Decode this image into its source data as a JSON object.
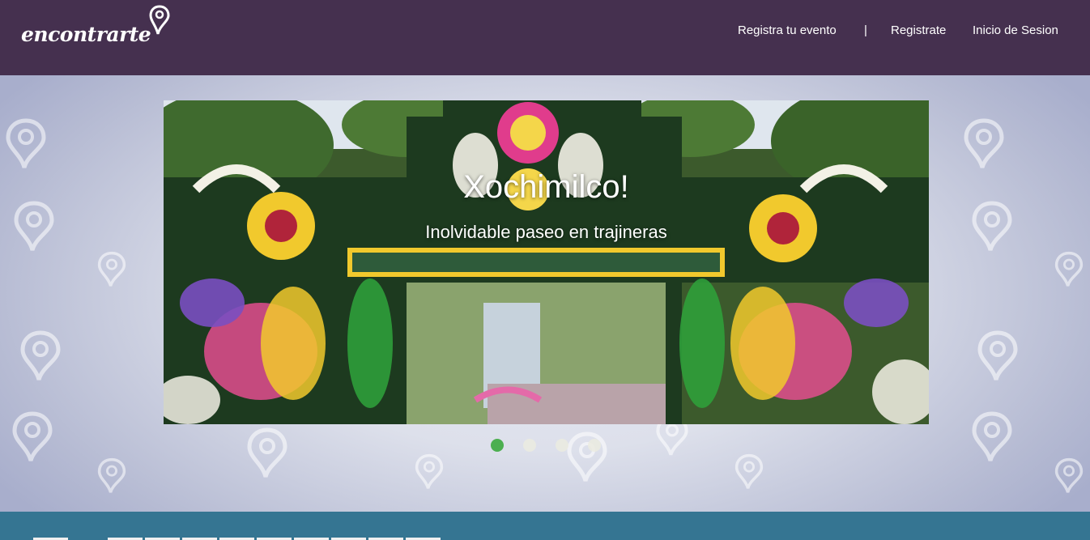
{
  "header": {
    "logo_text": "encontrarte",
    "nav": {
      "register_event": "Registra tu evento",
      "separator": "|",
      "register": "Registrate",
      "login": "Inicio de Sesion"
    }
  },
  "carousel": {
    "slide": {
      "title": "Xochimilco!",
      "subtitle": "Inolvidable paseo en trajineras"
    },
    "active_index": 0,
    "slide_count": 4
  },
  "colors": {
    "header_bg": "#45304f",
    "footer_bg": "#357592",
    "active_dot": "#4caf50"
  }
}
